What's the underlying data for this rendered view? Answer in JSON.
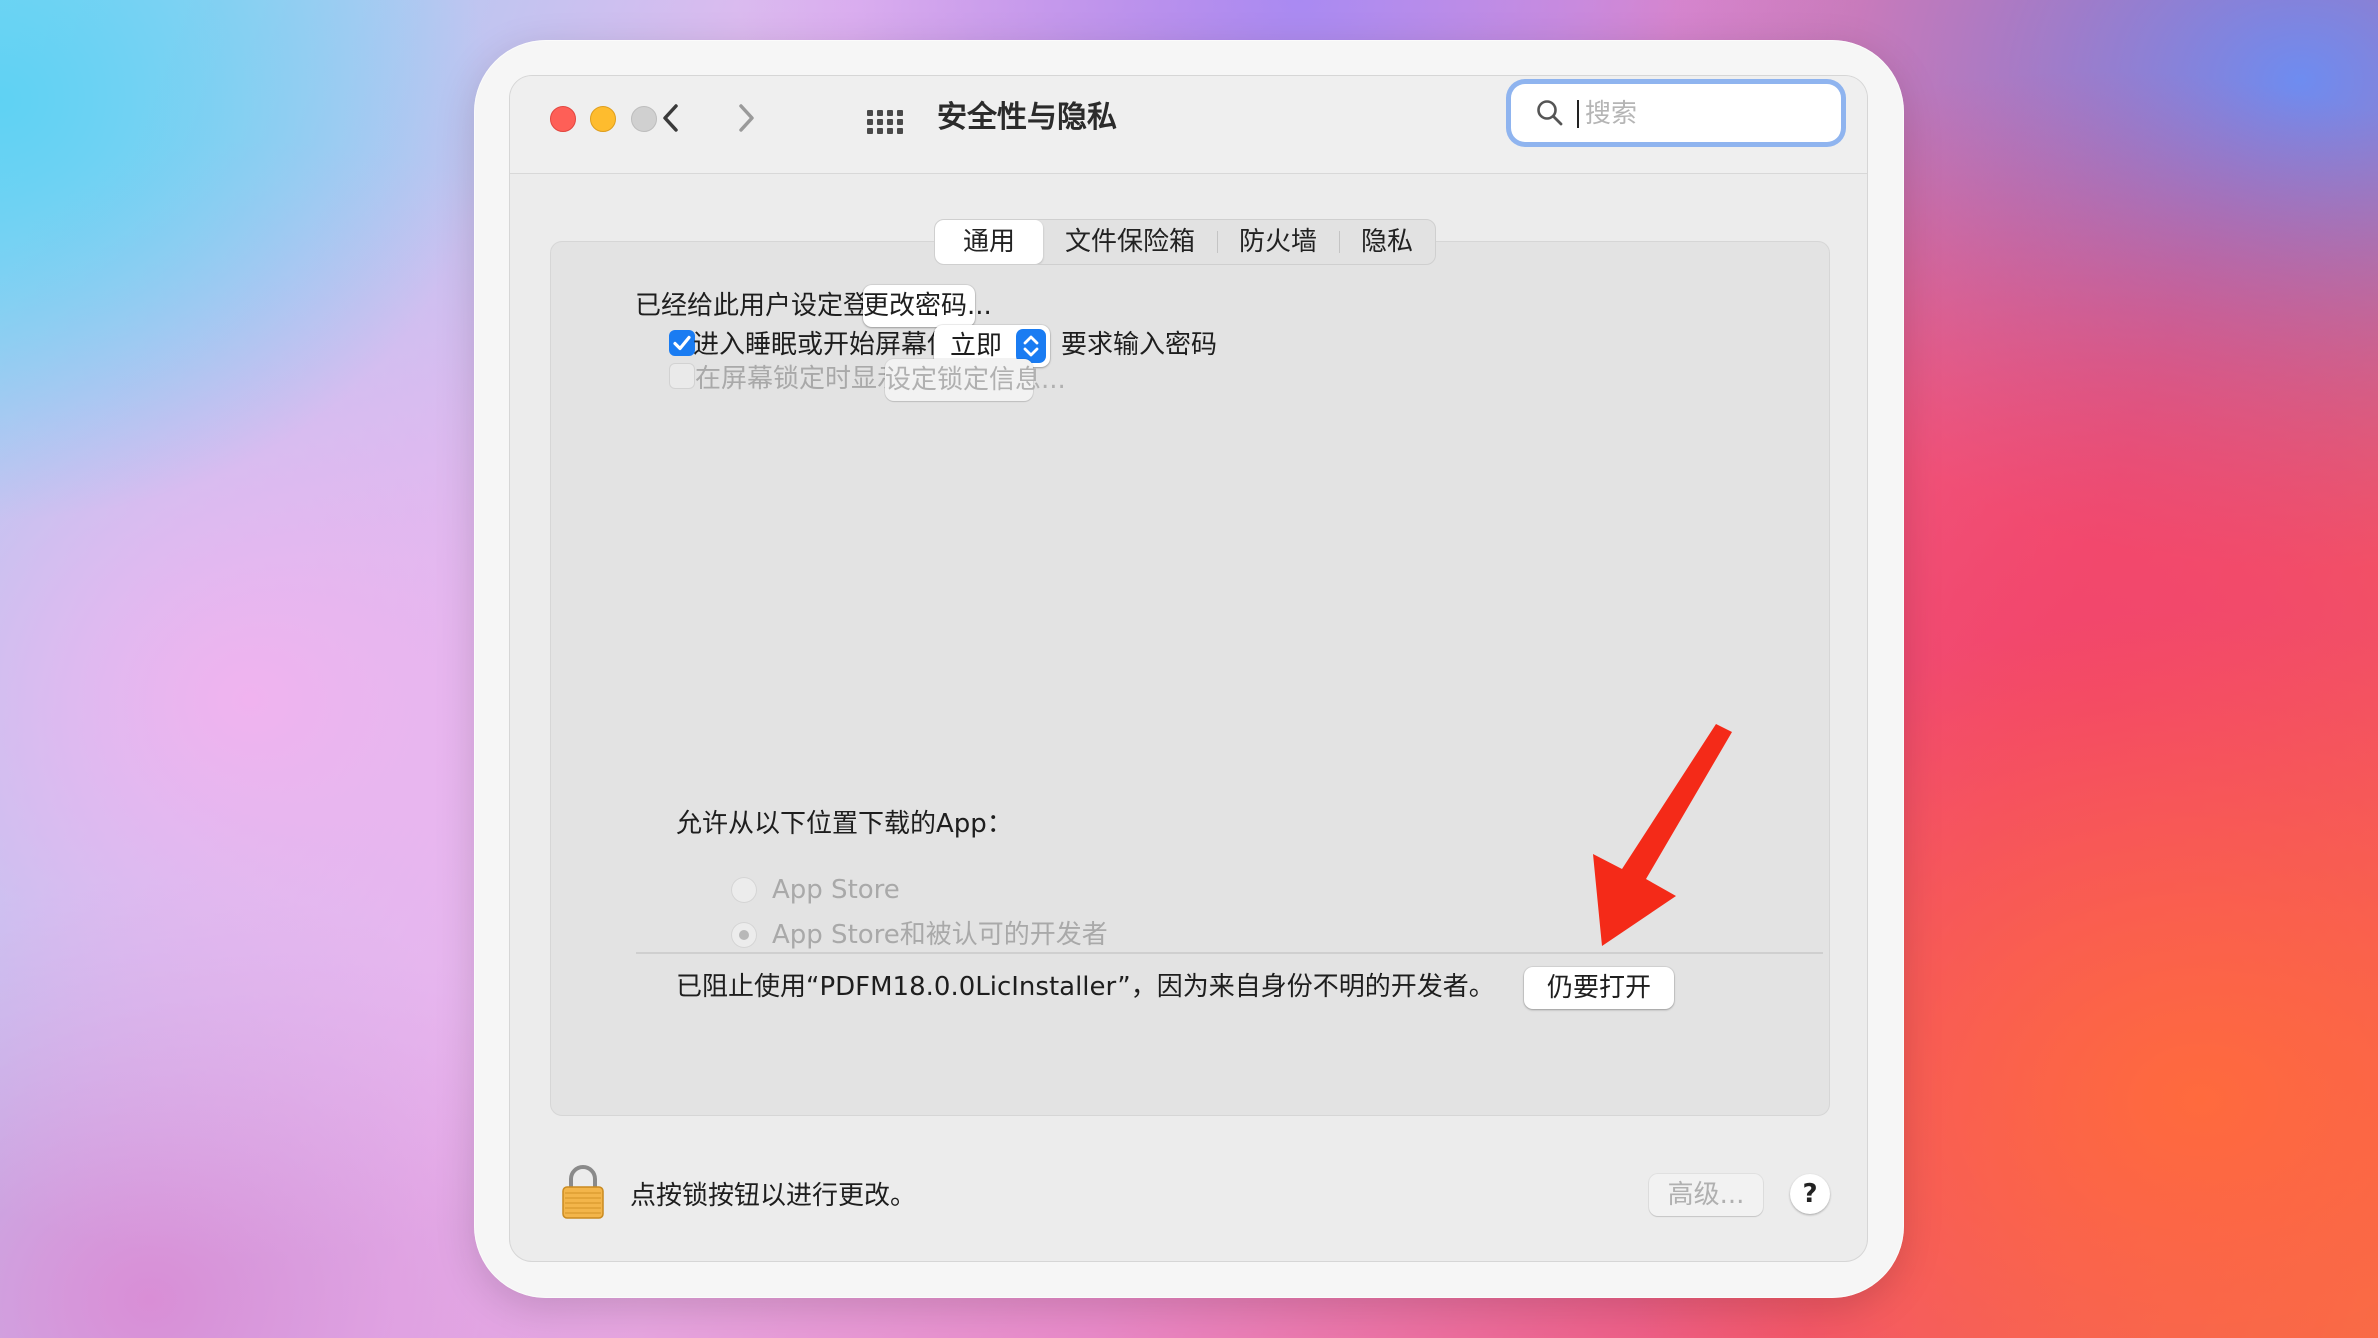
{
  "window": {
    "title": "安全性与隐私",
    "search_placeholder": "搜索"
  },
  "tabs": [
    "通用",
    "文件保险箱",
    "防火墙",
    "隐私"
  ],
  "active_tab": "通用",
  "general": {
    "password_set_label": "已经给此用户设定登录密码",
    "change_password_button": "更改密码...",
    "require_password": {
      "checked": true,
      "label": "进入睡眠或开始屏幕保护程序",
      "select_value": "立即",
      "suffix": "要求输入密码"
    },
    "lock_message": {
      "checked": false,
      "enabled": false,
      "label": "在屏幕锁定时显示信息",
      "button": "设定锁定信息..."
    }
  },
  "downloads": {
    "heading": "允许从以下位置下载的App：",
    "options": [
      {
        "label": "App Store",
        "selected": false
      },
      {
        "label": "App Store和被认可的开发者",
        "selected": true
      }
    ],
    "blocked_message": "已阻止使用“PDFM18.0.0LicInstaller”，因为来自身份不明的开发者。",
    "open_anyway_button": "仍要打开"
  },
  "footer": {
    "lock_text": "点按锁按钮以进行更改。",
    "advanced_button": "高级...",
    "help_button": "?"
  },
  "colors": {
    "accent": "#1a7cf2",
    "annotation_arrow": "#f42a18"
  },
  "icons": [
    "search-icon",
    "back-chevron-icon",
    "forward-chevron-icon",
    "grid-icon",
    "lock-icon",
    "checkmark-icon",
    "select-arrows-icon",
    "annotation-arrow"
  ]
}
